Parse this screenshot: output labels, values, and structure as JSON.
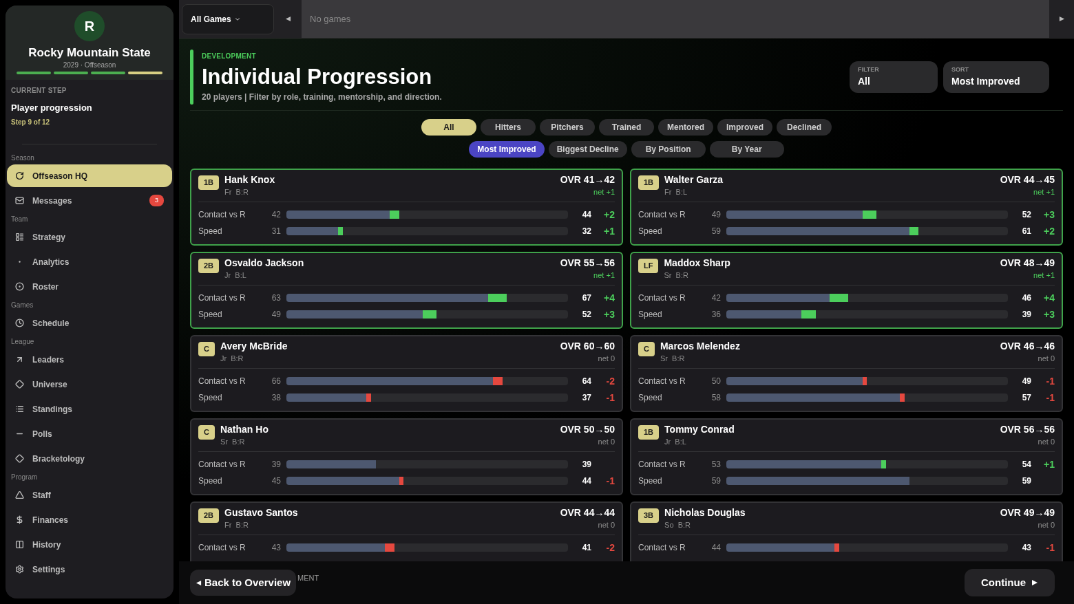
{
  "sidebar": {
    "logo_letter": "R",
    "team": "Rocky Mountain State",
    "season": "2029 · Offseason",
    "progress": [
      {
        "done": true
      },
      {
        "done": true
      },
      {
        "done": true
      },
      {
        "done": false
      }
    ],
    "current_step": {
      "label": "CURRENT STEP",
      "title": "Player progression",
      "step": "Step 9 of 12"
    },
    "sections": [
      {
        "title": "Season",
        "items": [
          {
            "label": "Offseason HQ",
            "selected": true
          },
          {
            "label": "Messages",
            "selected": false,
            "badge": "3"
          }
        ]
      },
      {
        "title": "Team",
        "items": [
          {
            "label": "Strategy",
            "selected": false
          },
          {
            "label": "Analytics",
            "selected": false
          },
          {
            "label": "Roster",
            "selected": false
          }
        ]
      },
      {
        "title": "Games",
        "items": [
          {
            "label": "Schedule",
            "selected": false
          }
        ]
      },
      {
        "title": "League",
        "items": [
          {
            "label": "Leaders",
            "selected": false
          },
          {
            "label": "Universe",
            "selected": false
          },
          {
            "label": "Standings",
            "selected": false
          },
          {
            "label": "Polls",
            "selected": false
          },
          {
            "label": "Bracketology",
            "selected": false
          }
        ]
      },
      {
        "title": "Program",
        "items": [
          {
            "label": "Staff",
            "selected": false
          },
          {
            "label": "Finances",
            "selected": false
          },
          {
            "label": "History",
            "selected": false
          },
          {
            "label": "Settings",
            "selected": false
          }
        ]
      }
    ]
  },
  "topbar": {
    "games_dropdown": "All Games",
    "status": "No games"
  },
  "header": {
    "eyebrow": "DEVELOPMENT",
    "title": "Individual Progression",
    "subtitle": "20 players | Filter by role, training, mentorship, and direction.",
    "selects": [
      {
        "label": "FILTER",
        "value": "All"
      },
      {
        "label": "SORT",
        "value": "Most Improved"
      }
    ]
  },
  "filters": [
    {
      "label": "All",
      "selected": true
    },
    {
      "label": "Hitters",
      "selected": false
    },
    {
      "label": "Pitchers",
      "selected": false
    },
    {
      "label": "Trained",
      "selected": false
    },
    {
      "label": "Mentored",
      "selected": false
    },
    {
      "label": "Improved",
      "selected": false
    },
    {
      "label": "Declined",
      "selected": false
    }
  ],
  "sorts": [
    {
      "label": "Most Improved",
      "selected": true
    },
    {
      "label": "Biggest Decline",
      "selected": false
    },
    {
      "label": "By Position",
      "selected": false
    },
    {
      "label": "By Year",
      "selected": false
    }
  ],
  "players": [
    {
      "pos": "1B",
      "name": "Hank Knox",
      "meta": "Fr  B:R",
      "ovr": "OVR 41→42",
      "net": "net +1",
      "improved": true,
      "stats": [
        {
          "label": "Contact vs R",
          "old": "42",
          "new": "44",
          "delta": "+2"
        },
        {
          "label": "Speed",
          "old": "31",
          "new": "32",
          "delta": "+1"
        }
      ]
    },
    {
      "pos": "1B",
      "name": "Walter Garza",
      "meta": "Fr  B:L",
      "ovr": "OVR 44→45",
      "net": "net +1",
      "improved": true,
      "stats": [
        {
          "label": "Contact vs R",
          "old": "49",
          "new": "52",
          "delta": "+3"
        },
        {
          "label": "Speed",
          "old": "59",
          "new": "61",
          "delta": "+2"
        }
      ]
    },
    {
      "pos": "2B",
      "name": "Osvaldo Jackson",
      "meta": "Jr  B:L",
      "ovr": "OVR 55→56",
      "net": "net +1",
      "improved": true,
      "stats": [
        {
          "label": "Contact vs R",
          "old": "63",
          "new": "67",
          "delta": "+4"
        },
        {
          "label": "Speed",
          "old": "49",
          "new": "52",
          "delta": "+3"
        }
      ]
    },
    {
      "pos": "LF",
      "name": "Maddox Sharp",
      "meta": "Sr  B:R",
      "ovr": "OVR 48→49",
      "net": "net +1",
      "improved": true,
      "stats": [
        {
          "label": "Contact vs R",
          "old": "42",
          "new": "46",
          "delta": "+4"
        },
        {
          "label": "Speed",
          "old": "36",
          "new": "39",
          "delta": "+3"
        }
      ]
    },
    {
      "pos": "C",
      "name": "Avery McBride",
      "meta": "Jr  B:R",
      "ovr": "OVR 60→60",
      "net": "net 0",
      "improved": false,
      "stats": [
        {
          "label": "Contact vs R",
          "old": "66",
          "new": "64",
          "delta": "-2"
        },
        {
          "label": "Speed",
          "old": "38",
          "new": "37",
          "delta": "-1"
        }
      ]
    },
    {
      "pos": "C",
      "name": "Marcos Melendez",
      "meta": "Sr  B:R",
      "ovr": "OVR 46→46",
      "net": "net 0",
      "improved": false,
      "stats": [
        {
          "label": "Contact vs R",
          "old": "50",
          "new": "49",
          "delta": "-1"
        },
        {
          "label": "Speed",
          "old": "58",
          "new": "57",
          "delta": "-1"
        }
      ]
    },
    {
      "pos": "C",
      "name": "Nathan Ho",
      "meta": "Sr  B:R",
      "ovr": "OVR 50→50",
      "net": "net 0",
      "improved": false,
      "stats": [
        {
          "label": "Contact vs R",
          "old": "39",
          "new": "39"
        },
        {
          "label": "Speed",
          "old": "45",
          "new": "44",
          "delta": "-1"
        }
      ]
    },
    {
      "pos": "1B",
      "name": "Tommy Conrad",
      "meta": "Jr  B:L",
      "ovr": "OVR 56→56",
      "net": "net 0",
      "improved": false,
      "stats": [
        {
          "label": "Contact vs R",
          "old": "53",
          "new": "54",
          "delta": "+1"
        },
        {
          "label": "Speed",
          "old": "59",
          "new": "59"
        }
      ]
    },
    {
      "pos": "2B",
      "name": "Gustavo Santos",
      "meta": "Fr  B:R",
      "ovr": "OVR 44→44",
      "net": "net 0",
      "improved": false,
      "stats": [
        {
          "label": "Contact vs R",
          "old": "43",
          "new": "41",
          "delta": "-2"
        }
      ]
    },
    {
      "pos": "3B",
      "name": "Nicholas Douglas",
      "meta": "So  B:R",
      "ovr": "OVR 49→49",
      "net": "net 0",
      "improved": false,
      "stats": [
        {
          "label": "Contact vs R",
          "old": "44",
          "new": "43",
          "delta": "-1"
        }
      ]
    }
  ],
  "footer": {
    "back": "Back to Overview",
    "behind_text": "MENT",
    "continue": "Continue"
  }
}
